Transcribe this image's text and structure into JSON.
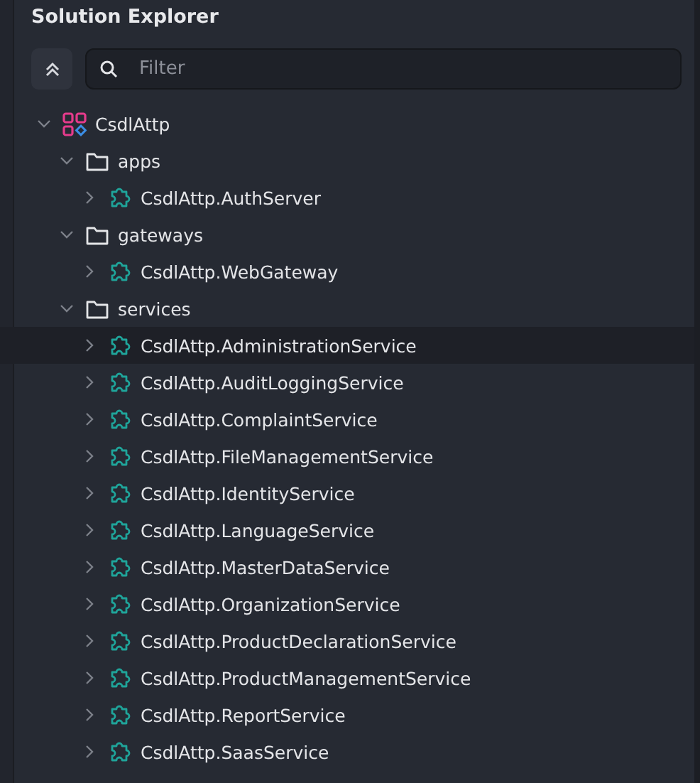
{
  "panel": {
    "title": "Solution Explorer"
  },
  "filter": {
    "placeholder": "Filter"
  },
  "tree": [
    {
      "kind": "solution",
      "label": "CsdlAttp",
      "expanded": true,
      "selected": false,
      "children": [
        {
          "kind": "folder",
          "label": "apps",
          "expanded": true,
          "selected": false,
          "children": [
            {
              "kind": "project",
              "label": "CsdlAttp.AuthServer",
              "expanded": false,
              "selected": false
            }
          ]
        },
        {
          "kind": "folder",
          "label": "gateways",
          "expanded": true,
          "selected": false,
          "children": [
            {
              "kind": "project",
              "label": "CsdlAttp.WebGateway",
              "expanded": false,
              "selected": false
            }
          ]
        },
        {
          "kind": "folder",
          "label": "services",
          "expanded": true,
          "selected": false,
          "children": [
            {
              "kind": "project",
              "label": "CsdlAttp.AdministrationService",
              "expanded": false,
              "selected": true
            },
            {
              "kind": "project",
              "label": "CsdlAttp.AuditLoggingService",
              "expanded": false,
              "selected": false
            },
            {
              "kind": "project",
              "label": "CsdlAttp.ComplaintService",
              "expanded": false,
              "selected": false
            },
            {
              "kind": "project",
              "label": "CsdlAttp.FileManagementService",
              "expanded": false,
              "selected": false
            },
            {
              "kind": "project",
              "label": "CsdlAttp.IdentityService",
              "expanded": false,
              "selected": false
            },
            {
              "kind": "project",
              "label": "CsdlAttp.LanguageService",
              "expanded": false,
              "selected": false
            },
            {
              "kind": "project",
              "label": "CsdlAttp.MasterDataService",
              "expanded": false,
              "selected": false
            },
            {
              "kind": "project",
              "label": "CsdlAttp.OrganizationService",
              "expanded": false,
              "selected": false
            },
            {
              "kind": "project",
              "label": "CsdlAttp.ProductDeclarationService",
              "expanded": false,
              "selected": false
            },
            {
              "kind": "project",
              "label": "CsdlAttp.ProductManagementService",
              "expanded": false,
              "selected": false
            },
            {
              "kind": "project",
              "label": "CsdlAttp.ReportService",
              "expanded": false,
              "selected": false
            },
            {
              "kind": "project",
              "label": "CsdlAttp.SaasService",
              "expanded": false,
              "selected": false
            }
          ]
        }
      ]
    }
  ]
}
